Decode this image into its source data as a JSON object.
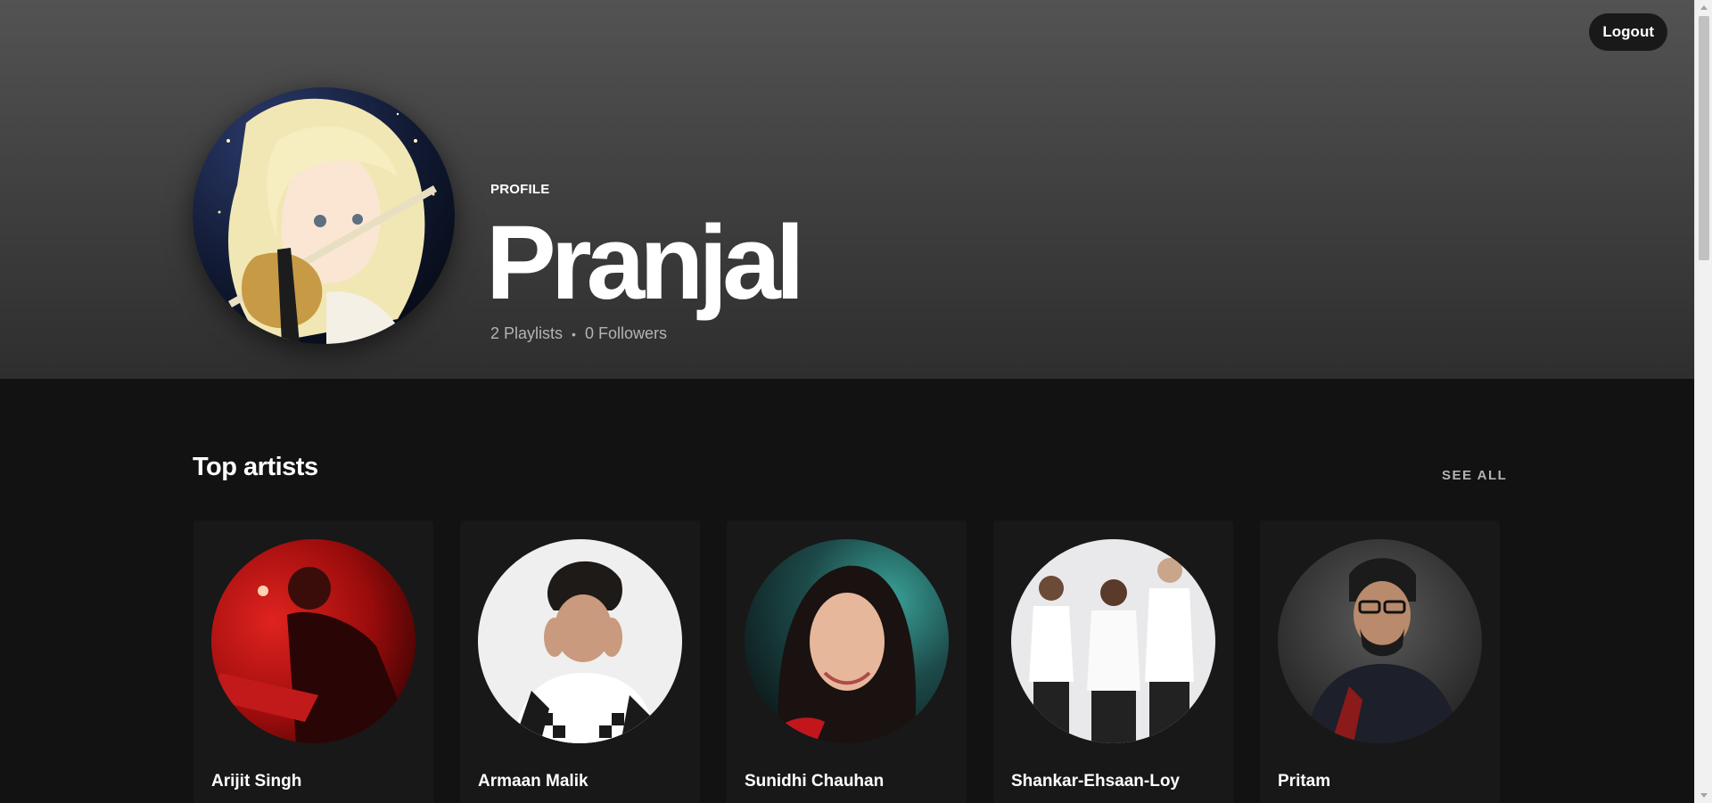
{
  "header": {
    "logout_label": "Logout"
  },
  "profile": {
    "label": "PROFILE",
    "name": "Pranjal",
    "playlists": "2 Playlists",
    "separator": "•",
    "followers": "0 Followers"
  },
  "top_artists": {
    "title": "Top artists",
    "see_all_label": "SEE ALL",
    "artists": [
      {
        "name": "Arijit Singh"
      },
      {
        "name": "Armaan Malik"
      },
      {
        "name": "Sunidhi Chauhan"
      },
      {
        "name": "Shankar-Ehsaan-Loy"
      },
      {
        "name": "Pritam"
      }
    ]
  },
  "colors": {
    "background": "#121212",
    "card": "#181818",
    "muted_text": "#b3b3b3",
    "hero_top": "#535353"
  }
}
